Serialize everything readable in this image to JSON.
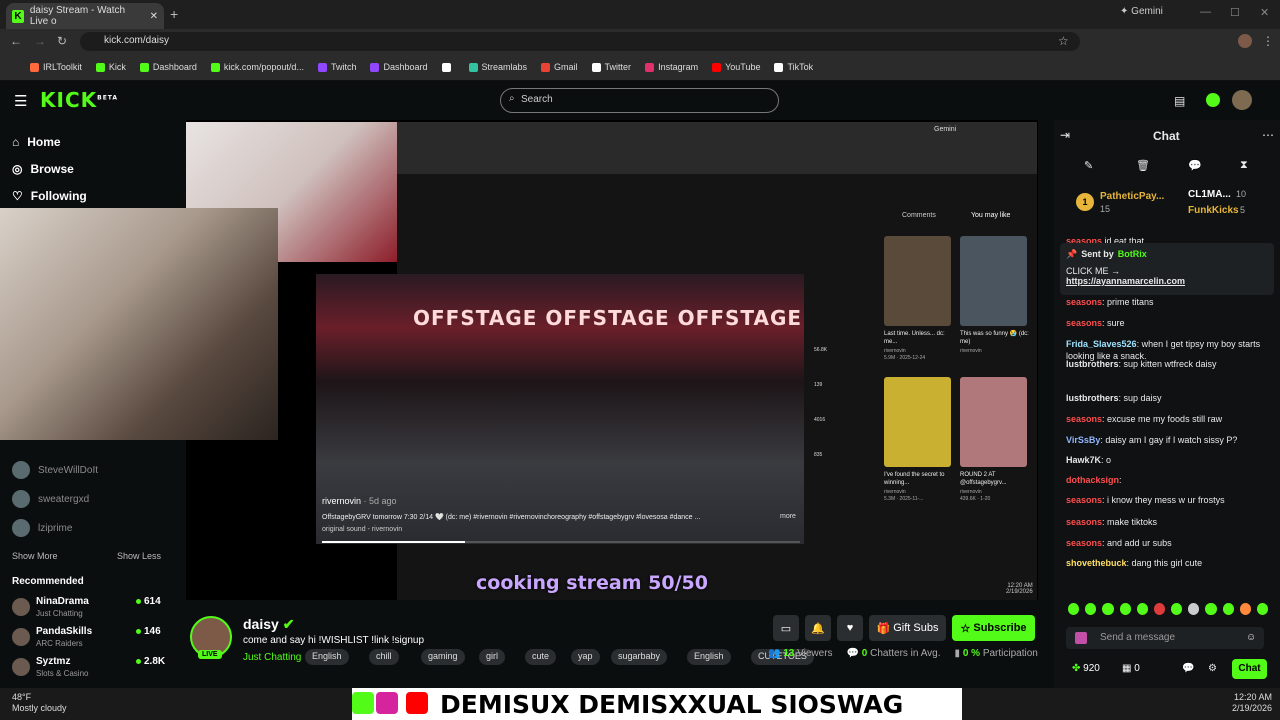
{
  "browser": {
    "tab_title": "daisy Stream - Watch Live o",
    "url": "kick.com/daisy",
    "gemini": "Gemini",
    "bookmarks": [
      "IRLToolkit",
      "Kick",
      "Dashboard",
      "kick.com/popout/d...",
      "Twitch",
      "Dashboard",
      "",
      "Streamlabs",
      "Gmail",
      "Twitter",
      "Instagram",
      "YouTube",
      "TikTok"
    ]
  },
  "header": {
    "logo": "KICK",
    "logo_sup": "BETA",
    "search_placeholder": "Search"
  },
  "sidebar": {
    "nav": [
      "Home",
      "Browse",
      "Following"
    ],
    "channels": [
      "SteveWillDoIt",
      "sweatergxd",
      "lziprime"
    ],
    "show_more": "Show More",
    "show_less": "Show Less",
    "recommended_title": "Recommended",
    "recommended": [
      {
        "name": "NinaDrama",
        "cat": "Just Chatting",
        "count": "614"
      },
      {
        "name": "PandaSkills",
        "cat": "ARC Raiders",
        "count": "146"
      },
      {
        "name": "Syztmz",
        "cat": "Slots & Casino",
        "count": "2.8K"
      }
    ]
  },
  "video": {
    "overlay_text": "cooking stream 50/50",
    "offstage": "OFFSTAGE OFFSTAGE OFFSTAGE",
    "channel": "rivernovin",
    "age": "· 5d ago",
    "caption": "OffstagebyGRV tomorrow 7:30 2/14 🤍 (dc: me) #rivernovin #rivernovinchoreography #offstagebygrv #lovesosa #dance ...",
    "more": "more",
    "sound": "original sound - rivernovin",
    "tabs": [
      "Comments",
      "You may like"
    ],
    "browser_inset_label": "Gemini",
    "thumbs": [
      {
        "t": "Last time. Unless... dc: me...",
        "c": "rivernovin",
        "v": "5.9M · 2025-12-24"
      },
      {
        "t": "This was so funny 😭 (dc: me)",
        "c": "rivernovin",
        "v": ""
      },
      {
        "t": "I've found the secret to winning...",
        "c": "rivernovin",
        "v": "5.3M · 2025-11-..."
      },
      {
        "t": "ROUND 2 AT @offstagebygrv...",
        "c": "rivernovin",
        "v": "439.6K · 1-20"
      }
    ],
    "side_counts": [
      "56.8K",
      "139",
      "4016",
      "835"
    ],
    "inset_time": "12:20 AM",
    "inset_date": "2/19/2026"
  },
  "stream": {
    "name": "daisy",
    "title": "come and say hi !WISHLIST !link !signup",
    "category": "Just Chatting",
    "live": "LIVE",
    "tags": [
      "English",
      "chill",
      "gaming",
      "girl",
      "cute",
      "yap",
      "sugarbaby",
      "English",
      "CUTETOES"
    ],
    "gift": "Gift Subs",
    "subscribe": "Subscribe",
    "viewers": "13",
    "viewers_label": "Viewers",
    "chatters": "0",
    "chatters_label": "Chatters in Avg.",
    "participation": "0 %",
    "participation_label": "Participation"
  },
  "chat": {
    "title": "Chat",
    "leaders": [
      {
        "rank": "1",
        "name": "PatheticPay...",
        "n": "15"
      },
      {
        "name": "CL1MA...",
        "n": "10"
      },
      {
        "name": "FunkKicks",
        "n": "5"
      }
    ],
    "pinned": {
      "sent_by": "Sent by",
      "bot": "BotRix",
      "line1": "CLICK ME →",
      "link": "https://ayannamarcelin.com"
    },
    "messages": [
      {
        "u": "seasons",
        "m": " id eat that",
        "c": "#ff4d4d"
      },
      {
        "u": "seasons",
        "m": ": prime titans",
        "c": "#ff4d4d"
      },
      {
        "u": "seasons",
        "m": ": sure",
        "c": "#ff4d4d"
      },
      {
        "u": "Frida_Slaves526",
        "m": ": when I get tipsy my boy starts looking like a snack.",
        "c": "#9ee3ff"
      },
      {
        "u": "lustbrothers",
        "m": ": sup kitten wtfreck daisy",
        "c": "#e8e8e8"
      },
      {
        "u": "lustbrothers",
        "m": ": sup daisy",
        "c": "#e8e8e8"
      },
      {
        "u": "seasons",
        "m": ": excuse me my foods still raw",
        "c": "#ff4d4d"
      },
      {
        "u": "VirSsBy",
        "m": ": daisy am I gay if I watch sissy P?",
        "c": "#8fb6ff"
      },
      {
        "u": "Hawk7K",
        "m": ": o",
        "c": "#e8e8e8"
      },
      {
        "u": "dothacksign",
        "m": ":",
        "c": "#ff4d4d"
      },
      {
        "u": "seasons",
        "m": ": i know they mess w ur frostys",
        "c": "#ff4d4d"
      },
      {
        "u": "seasons",
        "m": ": make tiktoks",
        "c": "#ff4d4d"
      },
      {
        "u": "seasons",
        "m": ": and add ur subs",
        "c": "#ff4d4d"
      },
      {
        "u": "shovethebuck",
        "m": ": dang this girl cute",
        "c": "#ffe066"
      }
    ],
    "placeholder": "Send a message",
    "points": "920",
    "zero": "0",
    "send": "Chat"
  },
  "overlay": {
    "banner": "DEMISUX DEMISXXUAL SIOSWAG"
  },
  "taskbar": {
    "temp": "48°F",
    "weather": "Mostly cloudy",
    "time": "12:20 AM",
    "date": "2/19/2026"
  },
  "colors": {
    "accent": "#53fc18"
  }
}
